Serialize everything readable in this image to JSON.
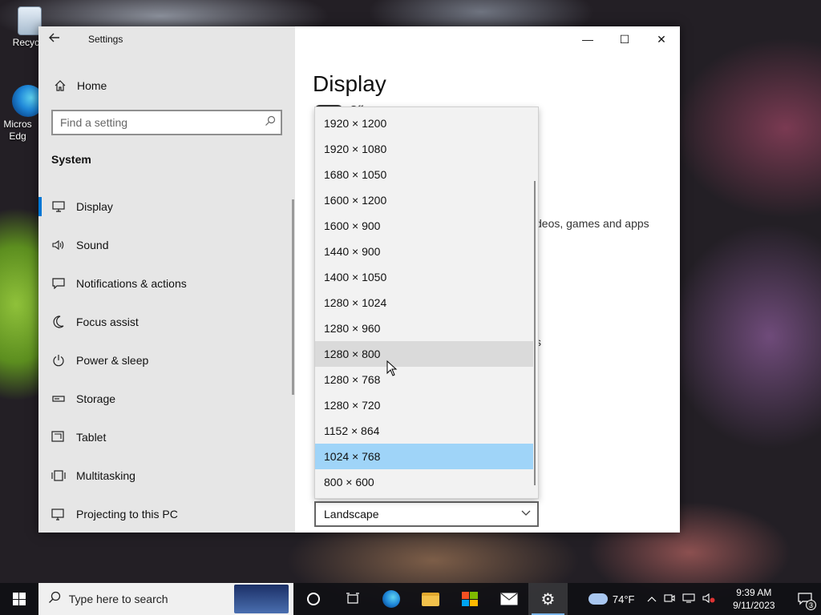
{
  "desktop": {
    "icons": [
      {
        "label": "Recycle",
        "icon": "recycle-bin-icon"
      },
      {
        "label": "Micros Edg",
        "icon": "edge-icon"
      }
    ]
  },
  "window": {
    "app_title": "Settings",
    "back_icon": "back-arrow-icon",
    "home_label": "Home",
    "search_placeholder": "Find a setting",
    "section_heading": "System",
    "nav": [
      {
        "label": "Display",
        "icon": "monitor-icon",
        "active": true
      },
      {
        "label": "Sound",
        "icon": "speaker-icon"
      },
      {
        "label": "Notifications & actions",
        "icon": "message-icon"
      },
      {
        "label": "Focus assist",
        "icon": "moon-icon"
      },
      {
        "label": "Power & sleep",
        "icon": "power-icon"
      },
      {
        "label": "Storage",
        "icon": "storage-icon"
      },
      {
        "label": "Tablet",
        "icon": "tablet-icon"
      },
      {
        "label": "Multitasking",
        "icon": "multitasking-icon"
      },
      {
        "label": "Projecting to this PC",
        "icon": "project-icon"
      }
    ],
    "caption": {
      "minimize": "—",
      "maximize": "☐",
      "close": "✕"
    }
  },
  "content": {
    "title": "Display",
    "toggle_state": "Off",
    "partial_text_1": "deos, games and apps",
    "partial_text_2": "s",
    "orientation_value": "Landscape"
  },
  "resolution_dropdown": {
    "options": [
      "1920 × 1200",
      "1920 × 1080",
      "1680 × 1050",
      "1600 × 1200",
      "1600 × 900",
      "1440 × 900",
      "1400 × 1050",
      "1280 × 1024",
      "1280 × 960",
      "1280 × 800",
      "1280 × 768",
      "1280 × 720",
      "1152 × 864",
      "1024 × 768",
      "800 × 600"
    ],
    "hovered": "1280 × 800",
    "selected": "1024 × 768"
  },
  "taskbar": {
    "search_placeholder": "Type here to search",
    "weather_temp": "74°F",
    "time": "9:39 AM",
    "date": "9/11/2023",
    "notification_count": "3"
  },
  "colors": {
    "accent": "#0078d7",
    "selected_bg": "#9fd4f8",
    "hover_bg": "#dadada"
  }
}
